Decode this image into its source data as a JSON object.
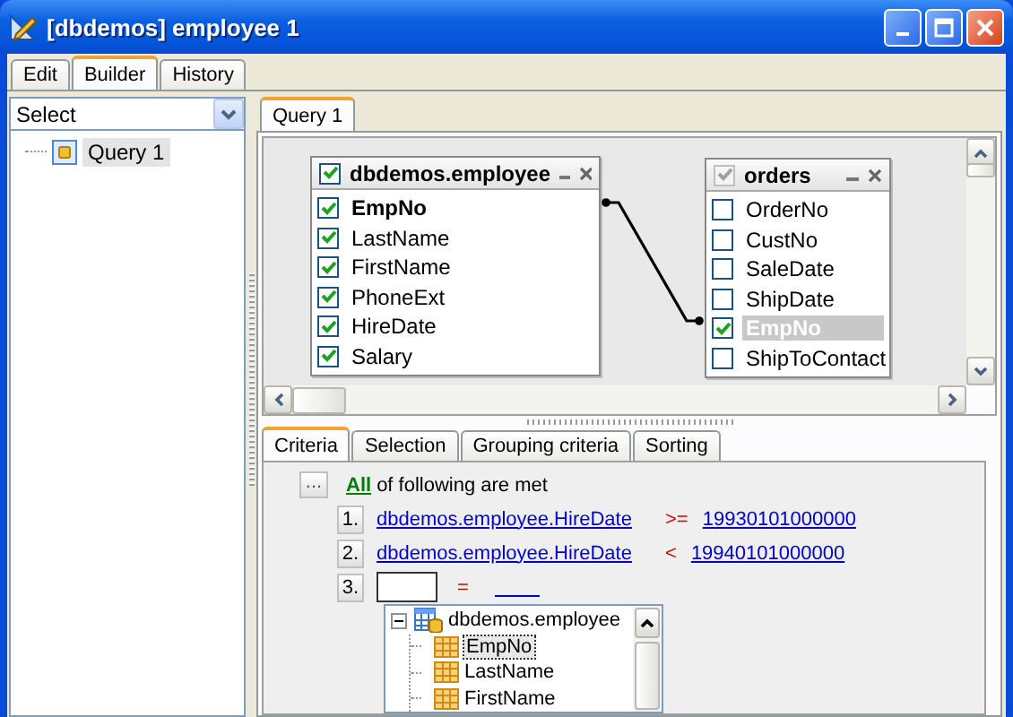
{
  "window": {
    "title": "[dbdemos] employee 1"
  },
  "tabs": [
    {
      "label": "Edit",
      "selected": false
    },
    {
      "label": "Builder",
      "selected": true
    },
    {
      "label": "History",
      "selected": false
    }
  ],
  "object_selector": {
    "value": "Select"
  },
  "query_tree": [
    {
      "label": "Query 1",
      "selected": true
    }
  ],
  "query_tabs": [
    {
      "label": "Query 1",
      "selected": true
    }
  ],
  "tables": [
    {
      "name": "dbdemos.employee",
      "checked": true,
      "disabled": false,
      "fields": [
        {
          "name": "EmpNo",
          "checked": true,
          "key": true,
          "selected": false
        },
        {
          "name": "LastName",
          "checked": true,
          "key": false,
          "selected": false
        },
        {
          "name": "FirstName",
          "checked": true,
          "key": false,
          "selected": false
        },
        {
          "name": "PhoneExt",
          "checked": true,
          "key": false,
          "selected": false
        },
        {
          "name": "HireDate",
          "checked": true,
          "key": false,
          "selected": false
        },
        {
          "name": "Salary",
          "checked": true,
          "key": false,
          "selected": false
        }
      ]
    },
    {
      "name": "orders",
      "checked": true,
      "disabled": true,
      "fields": [
        {
          "name": "OrderNo",
          "checked": false,
          "key": false,
          "selected": false
        },
        {
          "name": "CustNo",
          "checked": false,
          "key": false,
          "selected": false
        },
        {
          "name": "SaleDate",
          "checked": false,
          "key": false,
          "selected": false
        },
        {
          "name": "ShipDate",
          "checked": false,
          "key": false,
          "selected": false
        },
        {
          "name": "EmpNo",
          "checked": true,
          "key": true,
          "selected": true
        },
        {
          "name": "ShipToContact",
          "checked": false,
          "key": false,
          "selected": false
        }
      ]
    }
  ],
  "criteria_tabs": [
    {
      "label": "Criteria",
      "selected": true
    },
    {
      "label": "Selection",
      "selected": false
    },
    {
      "label": "Grouping criteria",
      "selected": false
    },
    {
      "label": "Sorting",
      "selected": false
    }
  ],
  "criteria": {
    "menu_button": "...",
    "quantifier": "All",
    "quantifier_text": "of following are met",
    "conditions": [
      {
        "kind": "link",
        "number": "1.",
        "field": "dbdemos.employee.HireDate",
        "operator": ">=",
        "value": "19930101000000"
      },
      {
        "kind": "link",
        "number": "2.",
        "field": "dbdemos.employee.HireDate",
        "operator": "<",
        "value": "19940101000000"
      },
      {
        "kind": "editing",
        "number": "3.",
        "operator": "="
      }
    ]
  },
  "field_picker": {
    "label": "dbdemos.employee",
    "expanded": true,
    "children": [
      {
        "label": "EmpNo",
        "selected": true
      },
      {
        "label": "LastName",
        "selected": false
      },
      {
        "label": "FirstName",
        "selected": false
      }
    ]
  }
}
